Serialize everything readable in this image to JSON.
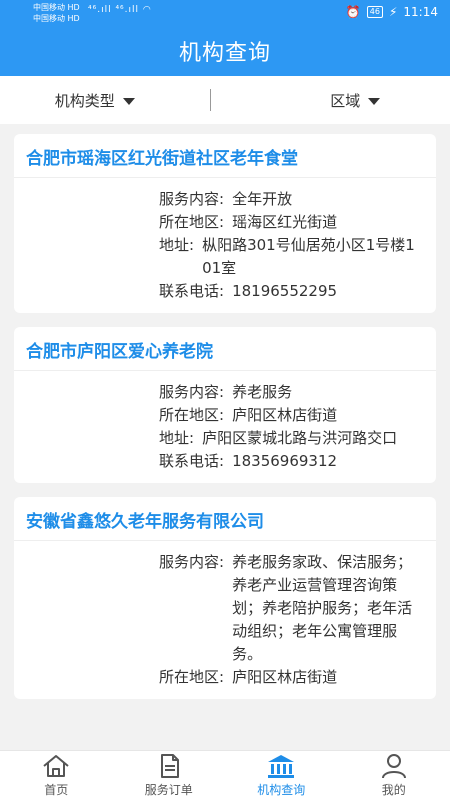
{
  "status": {
    "carrier1": "中国移动 HD",
    "carrier2": "中国移动 HD",
    "signal": "⁴⁶.ıll ⁴⁶.ıll",
    "battery": "46",
    "time": "11:14"
  },
  "header": {
    "title": "机构查询"
  },
  "filters": {
    "type_label": "机构类型",
    "region_label": "区域"
  },
  "labels": {
    "service": "服务内容:",
    "area": "所在地区:",
    "address": "地址:",
    "phone": "联系电话:"
  },
  "institutions": [
    {
      "name": "合肥市瑶海区红光街道社区老年食堂",
      "service": "全年开放",
      "area": "瑶海区红光街道",
      "address": "枞阳路301号仙居苑小区1号楼101室",
      "phone": "18196552295"
    },
    {
      "name": "合肥市庐阳区爱心养老院",
      "service": "养老服务",
      "area": "庐阳区林店街道",
      "address": "庐阳区蒙城北路与洪河路交口",
      "phone": "18356969312"
    },
    {
      "name": "安徽省鑫悠久老年服务有限公司",
      "service": "养老服务家政、保洁服务；养老产业运营管理咨询策划；养老陪护服务；老年活动组织；老年公寓管理服务。",
      "area": "庐阳区林店街道"
    }
  ],
  "tabs": [
    {
      "label": "首页",
      "icon": "home-icon"
    },
    {
      "label": "服务订单",
      "icon": "document-icon"
    },
    {
      "label": "机构查询",
      "icon": "institution-icon"
    },
    {
      "label": "我的",
      "icon": "user-icon"
    }
  ],
  "colors": {
    "primary": "#2d98f3",
    "title_text": "#1e8de8"
  }
}
